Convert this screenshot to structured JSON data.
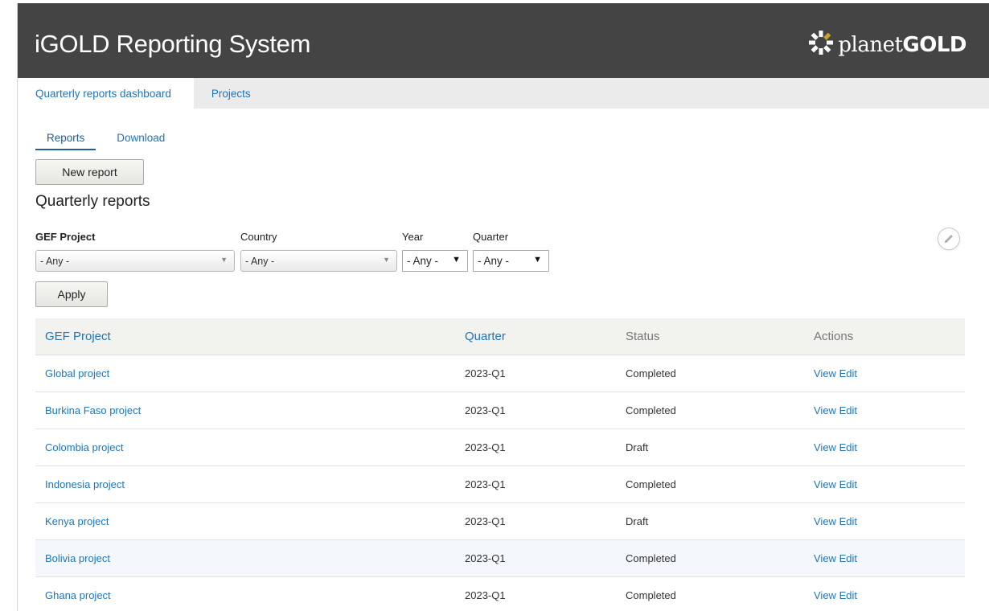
{
  "header": {
    "app_title": "iGOLD Reporting System",
    "logo_text_light": "planet",
    "logo_text_bold": "GOLD",
    "logo_icon": "planetgold-burst-icon",
    "background": "#444444",
    "logo_accent": "#c9a227"
  },
  "main_tabs": [
    {
      "label": "Quarterly reports dashboard",
      "active": true
    },
    {
      "label": "Projects",
      "active": false
    }
  ],
  "sub_tabs": [
    {
      "label": "Reports",
      "active": true
    },
    {
      "label": "Download",
      "active": false
    }
  ],
  "new_report_label": "New report",
  "section_title": "Quarterly reports",
  "filters": {
    "gef_project": {
      "label": "GEF Project",
      "value": "- Any -"
    },
    "country": {
      "label": "Country",
      "value": "- Any -"
    },
    "year": {
      "label": "Year",
      "value": "- Any -"
    },
    "quarter": {
      "label": "Quarter",
      "value": "- Any -"
    },
    "apply_label": "Apply"
  },
  "table": {
    "columns": [
      "GEF Project",
      "Quarter",
      "Status",
      "Actions"
    ],
    "rows": [
      {
        "project": "Global project",
        "quarter": "2023-Q1",
        "status": "Completed",
        "view": "View",
        "edit": "Edit"
      },
      {
        "project": "Burkina Faso project",
        "quarter": "2023-Q1",
        "status": "Completed",
        "view": "View",
        "edit": "Edit"
      },
      {
        "project": "Colombia project",
        "quarter": "2023-Q1",
        "status": "Draft",
        "view": "View",
        "edit": "Edit"
      },
      {
        "project": "Indonesia project",
        "quarter": "2023-Q1",
        "status": "Completed",
        "view": "View",
        "edit": "Edit"
      },
      {
        "project": "Kenya project",
        "quarter": "2023-Q1",
        "status": "Draft",
        "view": "View",
        "edit": "Edit"
      },
      {
        "project": "Bolivia project",
        "quarter": "2023-Q1",
        "status": "Completed",
        "view": "View",
        "edit": "Edit"
      },
      {
        "project": "Ghana project",
        "quarter": "2023-Q1",
        "status": "Completed",
        "view": "View",
        "edit": "Edit"
      }
    ]
  },
  "colors": {
    "link": "#1f75b6",
    "header_bg": "#444444",
    "tab_bar_bg": "#ebebeb"
  }
}
